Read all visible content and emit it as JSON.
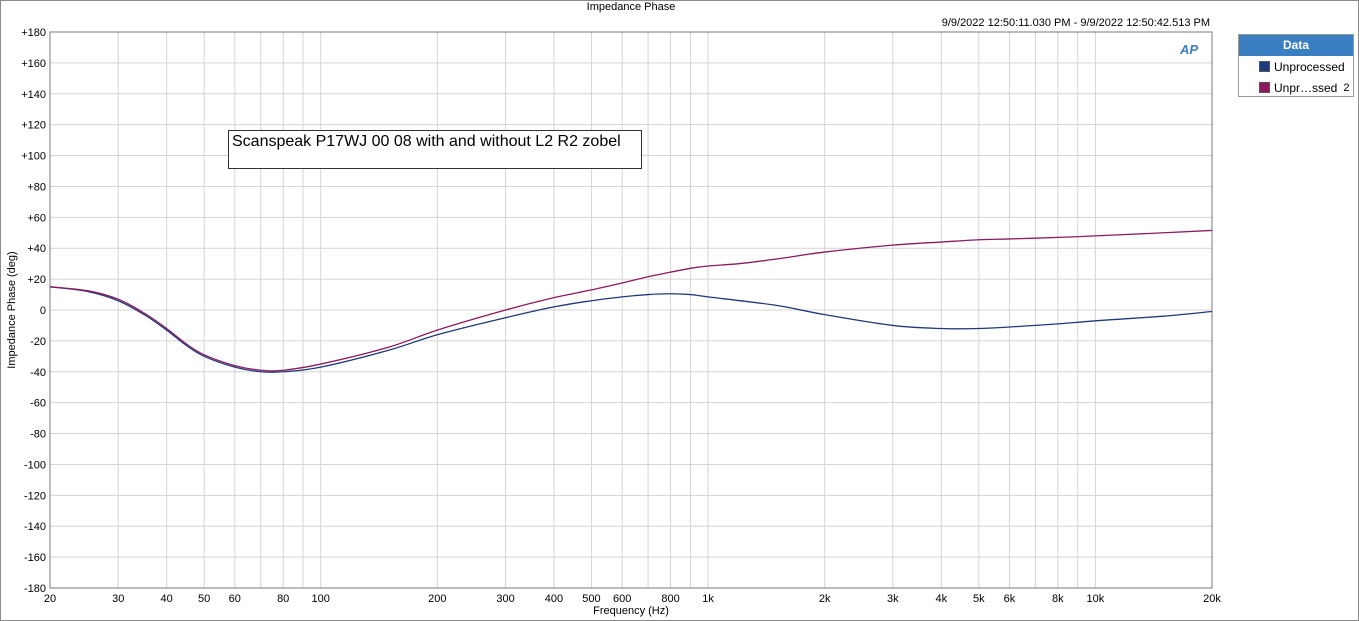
{
  "chart_data": {
    "type": "line",
    "title": "Impedance Phase",
    "time_range": "9/9/2022 12:50:11.030 PM - 9/9/2022 12:50:42.513 PM",
    "xlabel": "Frequency (Hz)",
    "ylabel": "Impedance Phase (deg)",
    "xscale": "log",
    "xlim": [
      20,
      20000
    ],
    "ylim": [
      -180,
      180
    ],
    "grid": true,
    "legend_position": "top-right outside",
    "x_ticks": [
      20,
      30,
      40,
      50,
      60,
      80,
      100,
      200,
      300,
      400,
      500,
      600,
      800,
      1000,
      2000,
      3000,
      4000,
      5000,
      6000,
      8000,
      10000,
      20000
    ],
    "x_tick_labels": [
      "20",
      "30",
      "40",
      "50",
      "60",
      "80",
      "100",
      "200",
      "300",
      "400",
      "500",
      "600",
      "800",
      "1k",
      "2k",
      "3k",
      "4k",
      "5k",
      "6k",
      "8k",
      "10k",
      "20k"
    ],
    "y_ticks": [
      180,
      160,
      140,
      120,
      100,
      80,
      60,
      40,
      20,
      0,
      -20,
      -40,
      -60,
      -80,
      -100,
      -120,
      -140,
      -160,
      -180
    ],
    "y_tick_labels": [
      "+180",
      "+160",
      "+140",
      "+120",
      "+100",
      "+80",
      "+60",
      "+40",
      "+20",
      "0",
      "-20",
      "-40",
      "-60",
      "-80",
      "-100",
      "-120",
      "-140",
      "-160",
      "-180"
    ],
    "series": [
      {
        "name": "Unprocessed",
        "color": "#1f3a7a",
        "points": [
          [
            20,
            15
          ],
          [
            25,
            12
          ],
          [
            30,
            6
          ],
          [
            35,
            -3
          ],
          [
            40,
            -13
          ],
          [
            45,
            -23
          ],
          [
            50,
            -30
          ],
          [
            60,
            -37
          ],
          [
            70,
            -40
          ],
          [
            80,
            -40
          ],
          [
            100,
            -37
          ],
          [
            150,
            -26
          ],
          [
            200,
            -16
          ],
          [
            300,
            -5
          ],
          [
            400,
            2
          ],
          [
            500,
            6
          ],
          [
            600,
            8.5
          ],
          [
            700,
            10
          ],
          [
            800,
            10.5
          ],
          [
            900,
            10
          ],
          [
            1000,
            8.5
          ],
          [
            1500,
            3
          ],
          [
            2000,
            -3
          ],
          [
            3000,
            -10
          ],
          [
            4000,
            -12
          ],
          [
            5000,
            -12
          ],
          [
            6000,
            -11
          ],
          [
            8000,
            -9
          ],
          [
            10000,
            -7
          ],
          [
            15000,
            -4
          ],
          [
            20000,
            -1
          ]
        ]
      },
      {
        "name": "Unpr…ssed 2",
        "color": "#8b1a5e",
        "points": [
          [
            20,
            15
          ],
          [
            25,
            12.5
          ],
          [
            30,
            7
          ],
          [
            35,
            -2
          ],
          [
            40,
            -12
          ],
          [
            45,
            -22
          ],
          [
            50,
            -29
          ],
          [
            60,
            -36
          ],
          [
            70,
            -39
          ],
          [
            80,
            -39
          ],
          [
            100,
            -35
          ],
          [
            150,
            -24
          ],
          [
            200,
            -13
          ],
          [
            300,
            0
          ],
          [
            400,
            8
          ],
          [
            500,
            13
          ],
          [
            600,
            17.5
          ],
          [
            700,
            21.5
          ],
          [
            800,
            24.5
          ],
          [
            900,
            27
          ],
          [
            1000,
            28.5
          ],
          [
            1200,
            30
          ],
          [
            1500,
            33
          ],
          [
            2000,
            37.5
          ],
          [
            3000,
            42
          ],
          [
            4000,
            44
          ],
          [
            5000,
            45.5
          ],
          [
            6000,
            46
          ],
          [
            8000,
            47
          ],
          [
            10000,
            48
          ],
          [
            15000,
            50
          ],
          [
            20000,
            51.5
          ]
        ]
      }
    ]
  },
  "legend": {
    "title": "Data",
    "items": [
      {
        "label": "Unprocessed",
        "suffix": "",
        "color": "#1f3a7a"
      },
      {
        "label": "Unpr…ssed",
        "suffix": "2",
        "color": "#8b1a5e"
      }
    ]
  },
  "annotation": "Scanspeak P17WJ 00 08 with and without L2 R2 zobel",
  "logo": "AP"
}
